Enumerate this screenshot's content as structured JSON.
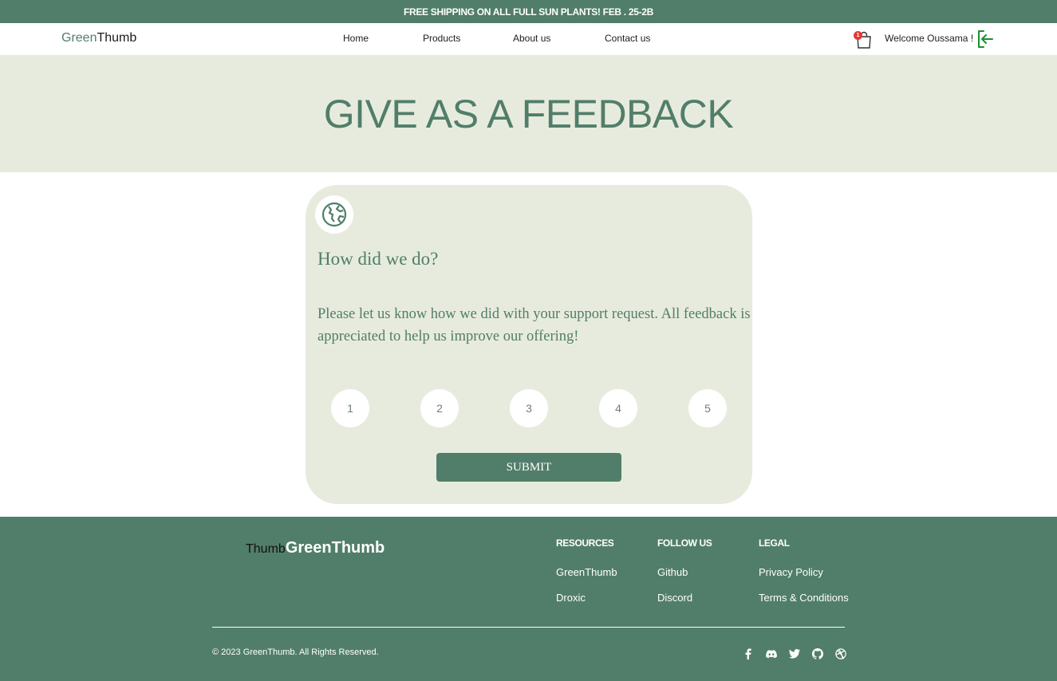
{
  "announcement": "FREE SHIPPING ON ALL FULL SUN PLANTS! FEB . 25-2B",
  "brand": {
    "part1": "Green",
    "part2": "Thumb"
  },
  "nav": {
    "home": "Home",
    "products": "Products",
    "about": "About us",
    "contact": "Contact us"
  },
  "cart": {
    "icon": "shopping-bag-icon",
    "count": "1"
  },
  "user": {
    "welcome": "Welcome Oussama !",
    "logout_icon": "logout-icon"
  },
  "hero": {
    "title": "GIVE AS A FEEDBACK"
  },
  "feedback": {
    "icon": "globe-icon",
    "title": "How did we do?",
    "text": "Please let us know how we did with your support request. All feedback is appreciated to help us improve our offering!",
    "ratings": [
      "1",
      "2",
      "3",
      "4",
      "5"
    ],
    "submit": "SUBMIT"
  },
  "footer": {
    "logo_dark": "Thumb",
    "logo_light": "GreenThumb",
    "resources": {
      "title": "RESOURCES",
      "links": [
        "GreenThumb",
        "Droxic"
      ]
    },
    "follow": {
      "title": "FOLLOW US",
      "links": [
        "Github",
        "Discord"
      ]
    },
    "legal": {
      "title": "LEGAL",
      "links": [
        "Privacy Policy",
        "Terms & Conditions"
      ]
    },
    "copyright": "© 2023 GreenThumb. All Rights Reserved.",
    "social_icons": [
      "facebook-icon",
      "discord-icon",
      "twitter-icon",
      "github-icon",
      "dribbble-icon"
    ]
  },
  "colors": {
    "primary": "#517e6a",
    "light": "#e7ebdd",
    "badge": "#e53935",
    "logout": "#1a8f2e"
  }
}
